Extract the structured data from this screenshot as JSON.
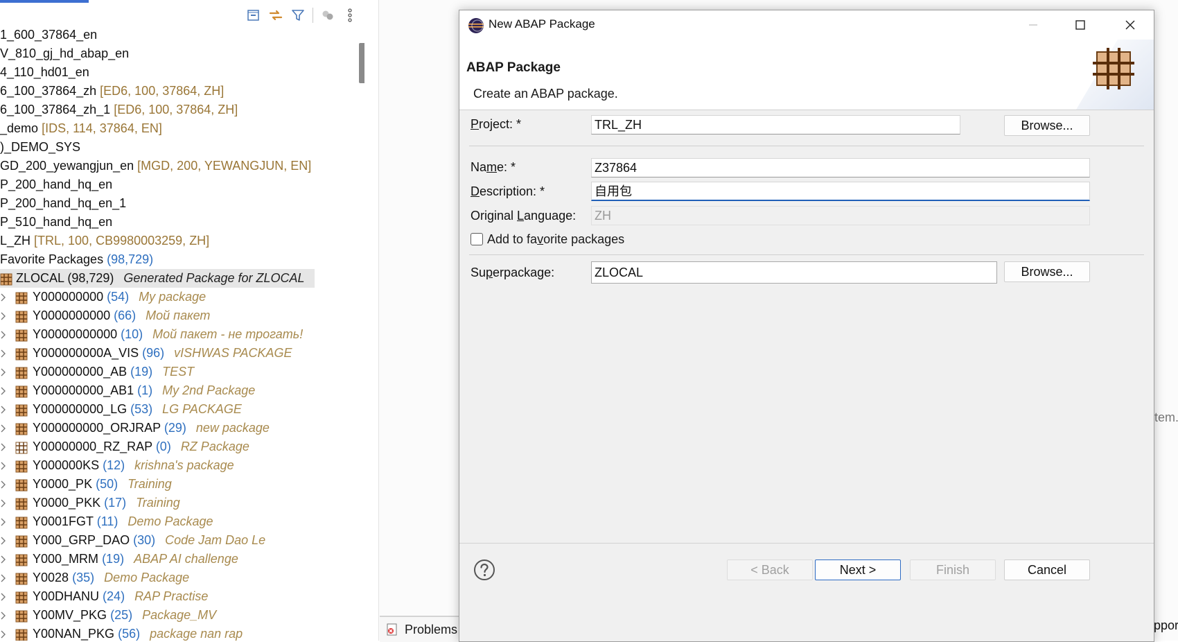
{
  "explorer": {
    "tree": [
      {
        "label": "1_600_37864_en"
      },
      {
        "label": "V_810_gj_hd_abap_en"
      },
      {
        "label": "4_110_hd01_en"
      },
      {
        "label": "6_100_37864_zh",
        "meta": "[ED6, 100, 37864, ZH]"
      },
      {
        "label": "6_100_37864_zh_1",
        "meta": "[ED6, 100, 37864, ZH]"
      },
      {
        "label": "_demo",
        "meta": "[IDS, 114, 37864, EN]"
      },
      {
        "label": ")_DEMO_SYS"
      },
      {
        "label": "GD_200_yewangjun_en",
        "meta": "[MGD, 200, YEWANGJUN, EN]"
      },
      {
        "label": "P_200_hand_hq_en"
      },
      {
        "label": "P_200_hand_hq_en_1"
      },
      {
        "label": "P_510_hand_hq_en"
      },
      {
        "label": "L_ZH",
        "meta": "[TRL, 100, CB9980003259, ZH]"
      },
      {
        "label": "Favorite Packages",
        "count": "(98,729)"
      }
    ],
    "root_package": {
      "label": "ZLOCAL (98,729)",
      "desc": "Generated Package for ZLOCAL"
    },
    "packages": [
      {
        "label": "Y000000000",
        "count": "(54)",
        "desc": "My package"
      },
      {
        "label": "Y0000000000",
        "count": "(66)",
        "desc": "Мой пакет"
      },
      {
        "label": "Y00000000000",
        "count": "(10)",
        "desc": "Мой пакет - не трогать!"
      },
      {
        "label": "Y000000000A_VIS",
        "count": "(96)",
        "desc": "vISHWAS PACKAGE"
      },
      {
        "label": "Y000000000_AB",
        "count": "(19)",
        "desc": "TEST"
      },
      {
        "label": "Y000000000_AB1",
        "count": "(1)",
        "desc": "My 2nd Package"
      },
      {
        "label": "Y000000000_LG",
        "count": "(53)",
        "desc": "LG PACKAGE"
      },
      {
        "label": "Y000000000_ORJRAP",
        "count": "(29)",
        "desc": "new package"
      },
      {
        "label": "Y00000000_RZ_RAP",
        "count": "(0)",
        "desc": "RZ Package"
      },
      {
        "label": "Y000000KS",
        "count": "(12)",
        "desc": "krishna's package"
      },
      {
        "label": "Y0000_PK",
        "count": "(50)",
        "desc": "Training"
      },
      {
        "label": "Y0000_PKK",
        "count": "(17)",
        "desc": "Training"
      },
      {
        "label": "Y0001FGT",
        "count": "(11)",
        "desc": "Demo Package"
      },
      {
        "label": "Y000_GRP_DAO",
        "count": "(30)",
        "desc": "Code Jam Dao Le"
      },
      {
        "label": "Y000_MRM",
        "count": "(19)",
        "desc": "ABAP AI challenge"
      },
      {
        "label": "Y0028",
        "count": "(35)",
        "desc": "Demo Package"
      },
      {
        "label": "Y00DHANU",
        "count": "(24)",
        "desc": "RAP Practise"
      },
      {
        "label": "Y00MV_PKG",
        "count": "(25)",
        "desc": "Package_MV"
      },
      {
        "label": "Y00NAN_PKG",
        "count": "(56)",
        "desc": "package nan rap"
      }
    ]
  },
  "editor": {
    "right_text": "tem.",
    "right_text_bottom": "ppor",
    "problems_tab": "Problems"
  },
  "dialog": {
    "title": "New ABAP Package",
    "banner_title": "ABAP Package",
    "banner_subtitle": "Create an ABAP package.",
    "project": {
      "label_pre": "",
      "label_u": "P",
      "label_post": "roject: *",
      "value": "TRL_ZH",
      "browse": "Browse..."
    },
    "name": {
      "label_pre": "Na",
      "label_u": "m",
      "label_post": "e: *",
      "value": "Z37864"
    },
    "description": {
      "label_pre": "",
      "label_u": "D",
      "label_post": "escription: *",
      "value": "自用包"
    },
    "original_language": {
      "label_pre": "Original ",
      "label_u": "L",
      "label_post": "anguage:",
      "value": "ZH"
    },
    "favorite": {
      "label_pre": "Add to fa",
      "label_u": "v",
      "label_post": "orite packages",
      "checked": false
    },
    "superpackage": {
      "label_pre": "Su",
      "label_u": "p",
      "label_post": "erpackage:",
      "value": "ZLOCAL",
      "browse": "Browse..."
    },
    "buttons": {
      "back": "< Back",
      "next": "Next >",
      "finish": "Finish",
      "cancel": "Cancel"
    },
    "colors": {
      "accent": "#2d6bc4",
      "focus": "#1f5fb8"
    }
  }
}
